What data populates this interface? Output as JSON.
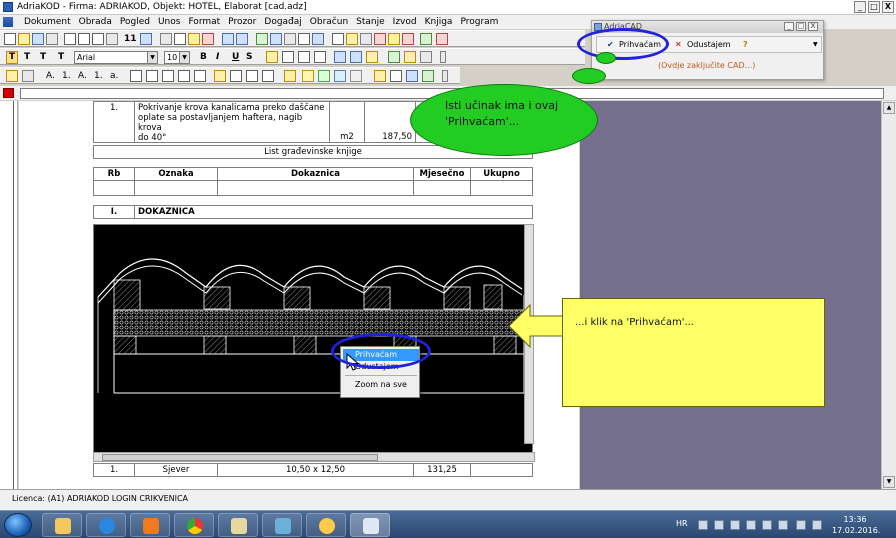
{
  "window": {
    "title": "AdriaKOD - Firma: ADRIAKOD,   Objekt: HOTEL, Elaborat [cad.adz]",
    "min": "_",
    "max": "□",
    "close": "X"
  },
  "menu": [
    "Dokument",
    "Obrada",
    "Pogled",
    "Unos",
    "Format",
    "Prozor",
    "Događaj",
    "Obračun",
    "Stanje",
    "Izvod",
    "Knjiga",
    "Program"
  ],
  "toolbar": {
    "font_name": "Arial",
    "font_size": "10",
    "bold": "B",
    "italic": "I",
    "underline": "U",
    "strike": "S",
    "text_T": "T",
    "num_11": "11",
    "numbering": [
      "A.",
      "1.",
      "A.",
      "1.",
      "a."
    ]
  },
  "document": {
    "row1": {
      "no": "1.",
      "description": [
        "Pokrivanje krova kanalicama preko daščane",
        "oplate sa postavljanjem haftera, nagib krova",
        "do 40°"
      ],
      "unit": "m2",
      "quantity": "187,50"
    },
    "list_title": "List građevinske knjige",
    "headers": [
      "Rb",
      "Oznaka",
      "Dokaznica",
      "Mjesečno",
      "Ukupno"
    ],
    "section": {
      "no": "I.",
      "title": "DOKAZNICA"
    },
    "row_bottom": {
      "no": "1.",
      "oznaka": "Sjever",
      "dokaznica": "10,50 x 12,50",
      "mjesecno": "131,25"
    }
  },
  "context_menu": {
    "items": [
      "Prihvaćam",
      "Odustajem",
      "Zoom na sve"
    ]
  },
  "adriacad": {
    "title": "AdriaCAD",
    "accept": "Prihvaćam",
    "cancel": "Odustajem",
    "help": "?",
    "hint": "(Ovdje zaključite CAD...)"
  },
  "callouts": {
    "green_line1": "Isti učinak ima i ovaj",
    "green_line2": "'Prihvaćam'...",
    "yellow": "...i klik na 'Prihvaćam'..."
  },
  "status": {
    "license": "Licenca: (A1) ADRIAKOD LOGIN CRIKVENICA"
  },
  "taskbar": {
    "lang": "HR",
    "time": "13:36",
    "date": "17.02.2016."
  },
  "colors": {
    "green_callout": "#22cc22",
    "yellow_callout": "#ffff66",
    "blue_ellipse": "#2222dd",
    "workspace": "#736f8c"
  }
}
